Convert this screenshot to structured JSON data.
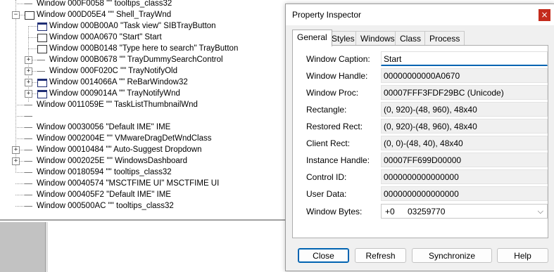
{
  "tree": {
    "rows": [
      {
        "label": "Window 000F0058 \"\" tooltips_class32"
      },
      {
        "label": "Window 000D05E4 \"\" Shell_TrayWnd"
      },
      {
        "label": "Window 000B00A0 \"Task view\" SIBTrayButton"
      },
      {
        "label": "Window 000A0670 \"Start\" Start"
      },
      {
        "label": "Window 000B0148 \"Type here to search\" TrayButton"
      },
      {
        "label": "Window 000B0678 \"\" TrayDummySearchControl"
      },
      {
        "label": "Window 000F020C \"\" TrayNotifyOld"
      },
      {
        "label": "Window 0014066A \"\" ReBarWindow32"
      },
      {
        "label": "Window 0009014A \"\" TrayNotifyWnd"
      },
      {
        "label": "Window 0011059E \"\" TaskListThumbnailWnd"
      },
      {
        "label": ""
      },
      {
        "label": "Window 00030056 \"Default IME\" IME"
      },
      {
        "label": "Window 0002004E \"\" VMwareDragDetWndClass"
      },
      {
        "label": "Window 00010484 \"\" Auto-Suggest Dropdown"
      },
      {
        "label": "Window 0002025E \"\" WindowsDashboard"
      },
      {
        "label": "Window 00180594 \"\" tooltips_class32"
      },
      {
        "label": "Window 00040574 \"MSCTFIME UI\" MSCTFIME UI"
      },
      {
        "label": "Window 000405F2 \"Default IME\" IME"
      },
      {
        "label": "Window 000500AC \"\" tooltips_class32"
      }
    ]
  },
  "dialog": {
    "title": "Property Inspector",
    "close_glyph": "×",
    "tabs": [
      "General",
      "Styles",
      "Windows",
      "Class",
      "Process"
    ],
    "fields": [
      {
        "label": "Window Caption:",
        "value": "Start"
      },
      {
        "label": "Window Handle:",
        "value": "00000000000A0670"
      },
      {
        "label": "Window Proc:",
        "value": "00007FFF3FDF29BC (Unicode)"
      },
      {
        "label": "Rectangle:",
        "value": "(0, 920)-(48, 960), 48x40"
      },
      {
        "label": "Restored Rect:",
        "value": "(0, 920)-(48, 960), 48x40"
      },
      {
        "label": "Client Rect:",
        "value": "(0, 0)-(48, 40), 48x40"
      },
      {
        "label": "Instance Handle:",
        "value": "00007FF699D00000"
      },
      {
        "label": "Control ID:",
        "value": "0000000000000000"
      },
      {
        "label": "User Data:",
        "value": "0000000000000000"
      }
    ],
    "window_bytes": {
      "label": "Window Bytes:",
      "value_a": "+0",
      "value_b": "03259770",
      "chevron": "⌵"
    },
    "buttons": {
      "close": "Close",
      "refresh": "Refresh",
      "synchronize": "Synchronize",
      "help": "Help"
    }
  }
}
